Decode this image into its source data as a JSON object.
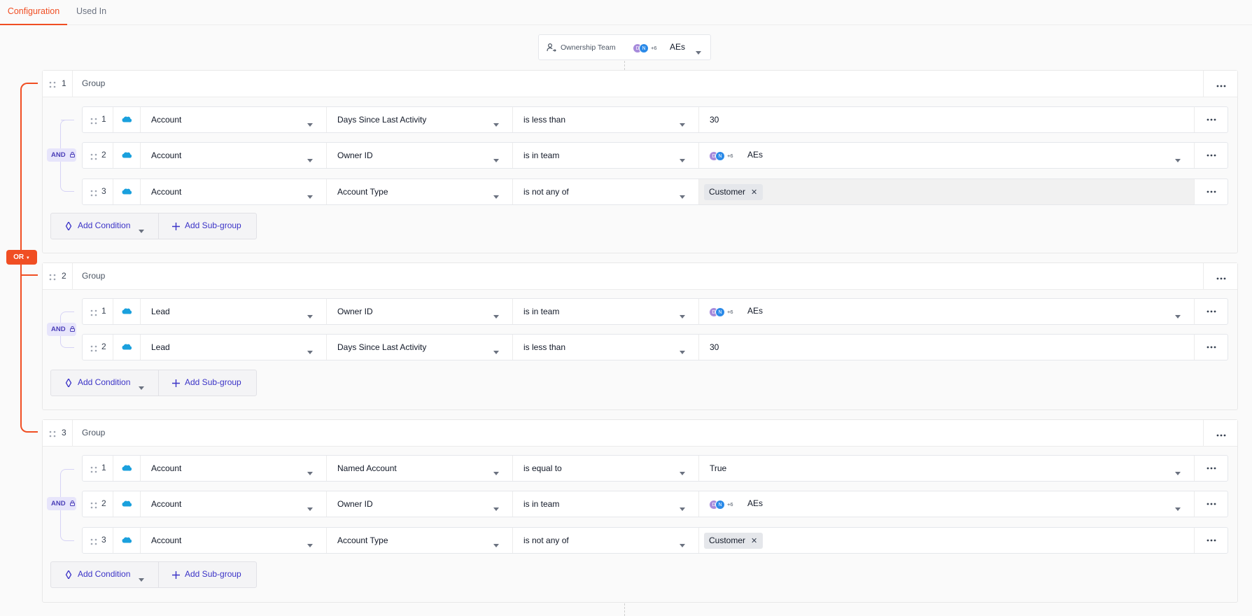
{
  "tabs": [
    {
      "label": "Configuration",
      "active": true
    },
    {
      "label": "Used In",
      "active": false
    }
  ],
  "ownership": {
    "label": "Ownership Team",
    "avatars": [
      "D",
      "N"
    ],
    "more": "+6",
    "value": "AEs"
  },
  "or_label": "OR",
  "and_label": "AND",
  "actions": {
    "add_condition": "Add Condition",
    "add_subgroup": "Add Sub-group"
  },
  "colors": {
    "accent": "#f04e23",
    "link": "#3b33c7",
    "salesforce": "#1aa0dd"
  },
  "groups": [
    {
      "number": "1",
      "title": "Group",
      "rows": [
        {
          "num": "1",
          "object": "Account",
          "field": "Days Since Last Activity",
          "operator": "is less than",
          "value_type": "input",
          "value": "30"
        },
        {
          "num": "2",
          "object": "Account",
          "field": "Owner ID",
          "operator": "is in team",
          "value_type": "team",
          "avatars": [
            "D",
            "N"
          ],
          "more": "+6",
          "value": "AEs"
        },
        {
          "num": "3",
          "object": "Account",
          "field": "Account Type",
          "operator": "is not any of",
          "value_type": "chips",
          "chips": [
            "Customer"
          ]
        }
      ]
    },
    {
      "number": "2",
      "title": "Group",
      "rows": [
        {
          "num": "1",
          "object": "Lead",
          "field": "Owner ID",
          "operator": "is in team",
          "value_type": "team",
          "avatars": [
            "D",
            "N"
          ],
          "more": "+6",
          "value": "AEs"
        },
        {
          "num": "2",
          "object": "Lead",
          "field": "Days Since Last Activity",
          "operator": "is less than",
          "value_type": "input",
          "value": "30"
        }
      ]
    },
    {
      "number": "3",
      "title": "Group",
      "rows": [
        {
          "num": "1",
          "object": "Account",
          "field": "Named Account",
          "operator": "is equal to",
          "value_type": "select",
          "value": "True"
        },
        {
          "num": "2",
          "object": "Account",
          "field": "Owner ID",
          "operator": "is in team",
          "value_type": "team",
          "avatars": [
            "D",
            "N"
          ],
          "more": "+6",
          "value": "AEs"
        },
        {
          "num": "3",
          "object": "Account",
          "field": "Account Type",
          "operator": "is not any of",
          "value_type": "chips",
          "chips": [
            "Customer"
          ]
        }
      ]
    }
  ]
}
